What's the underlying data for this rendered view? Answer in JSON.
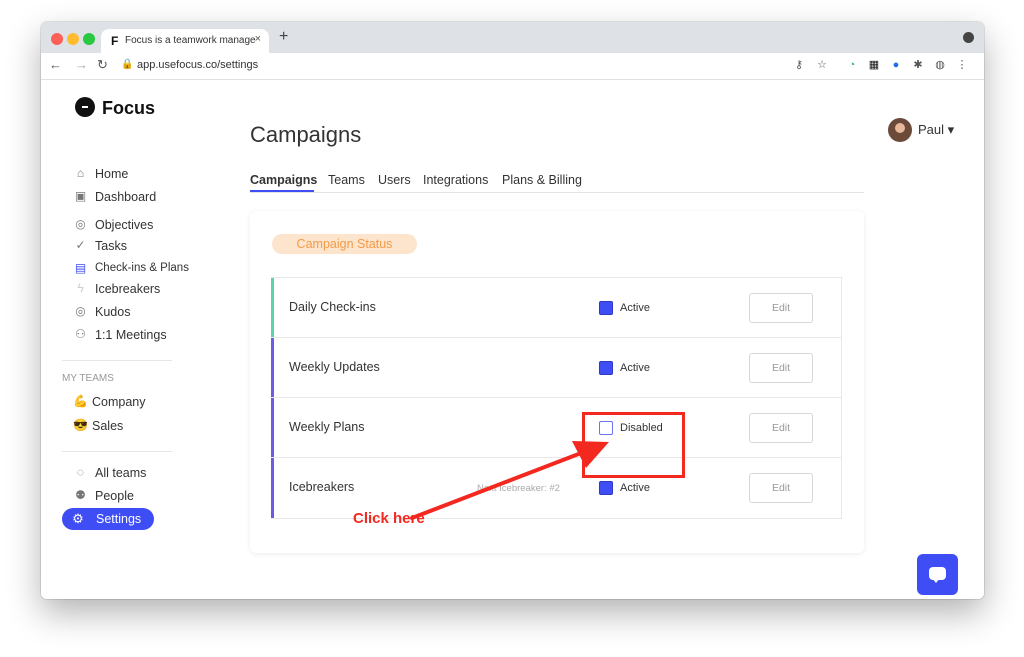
{
  "browser": {
    "tab_title": "Focus is a teamwork management",
    "tab_favicon": "F",
    "close_tab": "×",
    "new_tab": "+",
    "url": "app.usefocus.co/settings"
  },
  "app": {
    "logo": "Focus",
    "user_name": "Paul ▾"
  },
  "sidebar": {
    "items": [
      {
        "label": "Home",
        "icon": "⌂"
      },
      {
        "label": "Dashboard",
        "icon": "▣"
      },
      {
        "label": "Objectives",
        "icon": "◎"
      },
      {
        "label": "Tasks",
        "icon": "✓"
      },
      {
        "label": "Check-ins & Plans",
        "icon": "▤"
      },
      {
        "label": "Icebreakers",
        "icon": "ϟ"
      },
      {
        "label": "Kudos",
        "icon": "◎"
      },
      {
        "label": "1:1 Meetings",
        "icon": "⚇"
      }
    ],
    "my_teams_label": "MY TEAMS",
    "teams": [
      {
        "label": "Company",
        "icon": "💪"
      },
      {
        "label": "Sales",
        "icon": "😎"
      }
    ],
    "bottom": [
      {
        "label": "All teams",
        "icon": "◌"
      },
      {
        "label": "People",
        "icon": "⚉"
      }
    ],
    "settings_label": "Settings",
    "settings_icon": "⚙"
  },
  "main": {
    "title": "Campaigns",
    "tabs": [
      "Campaigns",
      "Teams",
      "Users",
      "Integrations",
      "Plans & Billing"
    ],
    "section_badge": "Campaign Status",
    "campaigns": [
      {
        "name": "Daily Check-ins",
        "status": "Active",
        "active": true,
        "note": "",
        "edit": "Edit",
        "accent": "#5fd4a8"
      },
      {
        "name": "Weekly Updates",
        "status": "Active",
        "active": true,
        "note": "",
        "edit": "Edit",
        "accent": "#6b5ce7"
      },
      {
        "name": "Weekly Plans",
        "status": "Disabled",
        "active": false,
        "note": "",
        "edit": "Edit",
        "accent": "#6b5ce7"
      },
      {
        "name": "Icebreakers",
        "status": "Active",
        "active": true,
        "note": "Next Icebreaker: #2",
        "edit": "Edit",
        "accent": "#6b5ce7"
      }
    ]
  },
  "annotation": {
    "text": "Click here",
    "color": "#f3281f"
  },
  "colors": {
    "accent": "#3f4df5",
    "badge_bg": "#fde4cd",
    "badge_text": "#f39b47"
  }
}
